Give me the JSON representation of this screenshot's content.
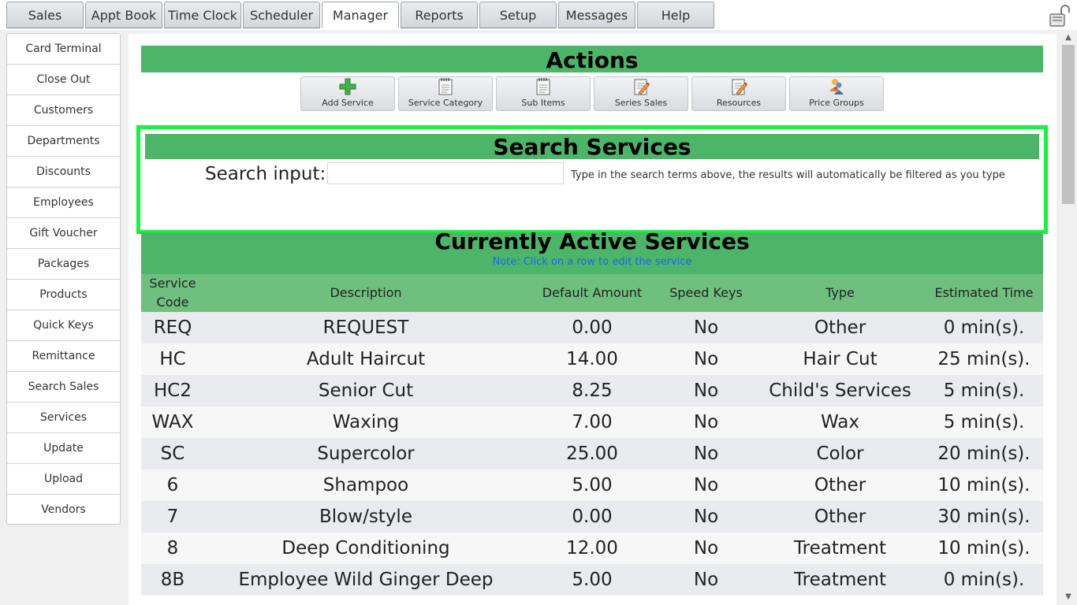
{
  "tabs": [
    {
      "label": "Sales"
    },
    {
      "label": "Appt Book"
    },
    {
      "label": "Time Clock"
    },
    {
      "label": "Scheduler"
    },
    {
      "label": "Manager"
    },
    {
      "label": "Reports"
    },
    {
      "label": "Setup"
    },
    {
      "label": "Messages"
    },
    {
      "label": "Help"
    }
  ],
  "active_tab": "Manager",
  "sidebar": {
    "items": [
      {
        "label": "Card Terminal"
      },
      {
        "label": "Close Out"
      },
      {
        "label": "Customers"
      },
      {
        "label": "Departments"
      },
      {
        "label": "Discounts"
      },
      {
        "label": "Employees"
      },
      {
        "label": "Gift Voucher"
      },
      {
        "label": "Packages"
      },
      {
        "label": "Products"
      },
      {
        "label": "Quick Keys"
      },
      {
        "label": "Remittance"
      },
      {
        "label": "Search Sales"
      },
      {
        "label": "Services"
      },
      {
        "label": "Update"
      },
      {
        "label": "Upload"
      },
      {
        "label": "Vendors"
      }
    ]
  },
  "actions": {
    "title": "Actions",
    "buttons": [
      {
        "label": "Add Service",
        "icon": "plus-icon"
      },
      {
        "label": "Service Category",
        "icon": "notepad-icon"
      },
      {
        "label": "Sub Items",
        "icon": "notepad-icon"
      },
      {
        "label": "Series Sales",
        "icon": "pencil-paper-icon"
      },
      {
        "label": "Resources",
        "icon": "pencil-paper-icon"
      },
      {
        "label": "Price Groups",
        "icon": "users-icon"
      }
    ]
  },
  "search": {
    "title": "Search Services",
    "label": "Search input:",
    "value": "",
    "placeholder": "",
    "hint": "Type in the search terms above, the results will automatically be filtered as you type"
  },
  "services": {
    "title": "Currently Active Services",
    "note": "Note: Click on a row to edit the service",
    "columns": [
      "Service Code",
      "Description",
      "Default Amount",
      "Speed Keys",
      "Type",
      "Estimated Time"
    ],
    "rows": [
      [
        "REQ",
        "REQUEST",
        "0.00",
        "No",
        "Other",
        "0 min(s)."
      ],
      [
        "HC",
        "Adult Haircut",
        "14.00",
        "No",
        "Hair Cut",
        "25 min(s)."
      ],
      [
        "HC2",
        "Senior Cut",
        "8.25",
        "No",
        "Child's Services",
        "5 min(s)."
      ],
      [
        "WAX",
        "Waxing",
        "7.00",
        "No",
        "Wax",
        "5 min(s)."
      ],
      [
        "SC",
        "Supercolor",
        "25.00",
        "No",
        "Color",
        "20 min(s)."
      ],
      [
        "6",
        "Shampoo",
        "5.00",
        "No",
        "Other",
        "10 min(s)."
      ],
      [
        "7",
        "Blow/style",
        "0.00",
        "No",
        "Other",
        "30 min(s)."
      ],
      [
        "8",
        "Deep Conditioning",
        "12.00",
        "No",
        "Treatment",
        "10 min(s)."
      ],
      [
        "8B",
        "Employee Wild Ginger Deep",
        "5.00",
        "No",
        "Treatment",
        "0 min(s)."
      ]
    ]
  },
  "colors": {
    "header_green": "#4cb568",
    "table_header_green": "#6fc07f",
    "highlight_border": "#17f23c",
    "note_blue": "#1565ff"
  }
}
